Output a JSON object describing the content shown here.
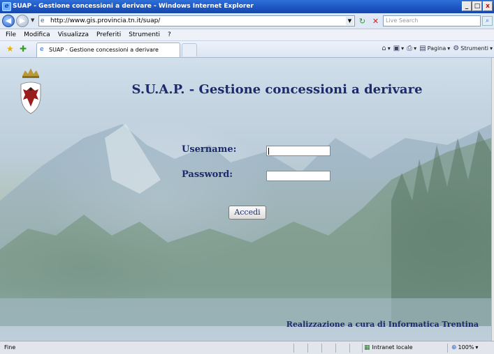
{
  "window": {
    "title": "SUAP - Gestione concessioni a derivare - Windows Internet Explorer",
    "controls": {
      "minimize": "_",
      "maximize": "□",
      "close": "x"
    }
  },
  "address_bar": {
    "url": "http://www.gis.provincia.tn.it/suap/",
    "search_placeholder": "Live Search"
  },
  "menu": {
    "items": [
      "File",
      "Modifica",
      "Visualizza",
      "Preferiti",
      "Strumenti",
      "?"
    ]
  },
  "tabs": {
    "active_label": "SUAP - Gestione concessioni a derivare"
  },
  "command_bar": {
    "page_label": "Pagina",
    "tools_label": "Strumenti"
  },
  "page": {
    "title": "S.U.A.P. - Gestione concessioni a derivare",
    "username_label": "Username:",
    "password_label": "Password:",
    "username_value": "",
    "password_value": "",
    "login_button": "Accedi",
    "credit": "Realizzazione a cura di Informatica Trentina"
  },
  "status_bar": {
    "status_text": "Fine",
    "zone": "Intranet locale",
    "zoom": "100%"
  },
  "icons": {
    "app": "ie-icon",
    "back": "back-arrow-icon",
    "forward": "forward-arrow-icon",
    "refresh": "refresh-icon",
    "stop": "stop-icon",
    "search": "search-icon",
    "favorites": "favorites-star-icon",
    "add_favorites": "add-favorites-icon",
    "home": "home-icon",
    "feeds": "feeds-icon",
    "print": "print-icon",
    "page": "page-icon",
    "tools": "tools-icon",
    "crest": "trentino-eagle-crest-icon"
  }
}
